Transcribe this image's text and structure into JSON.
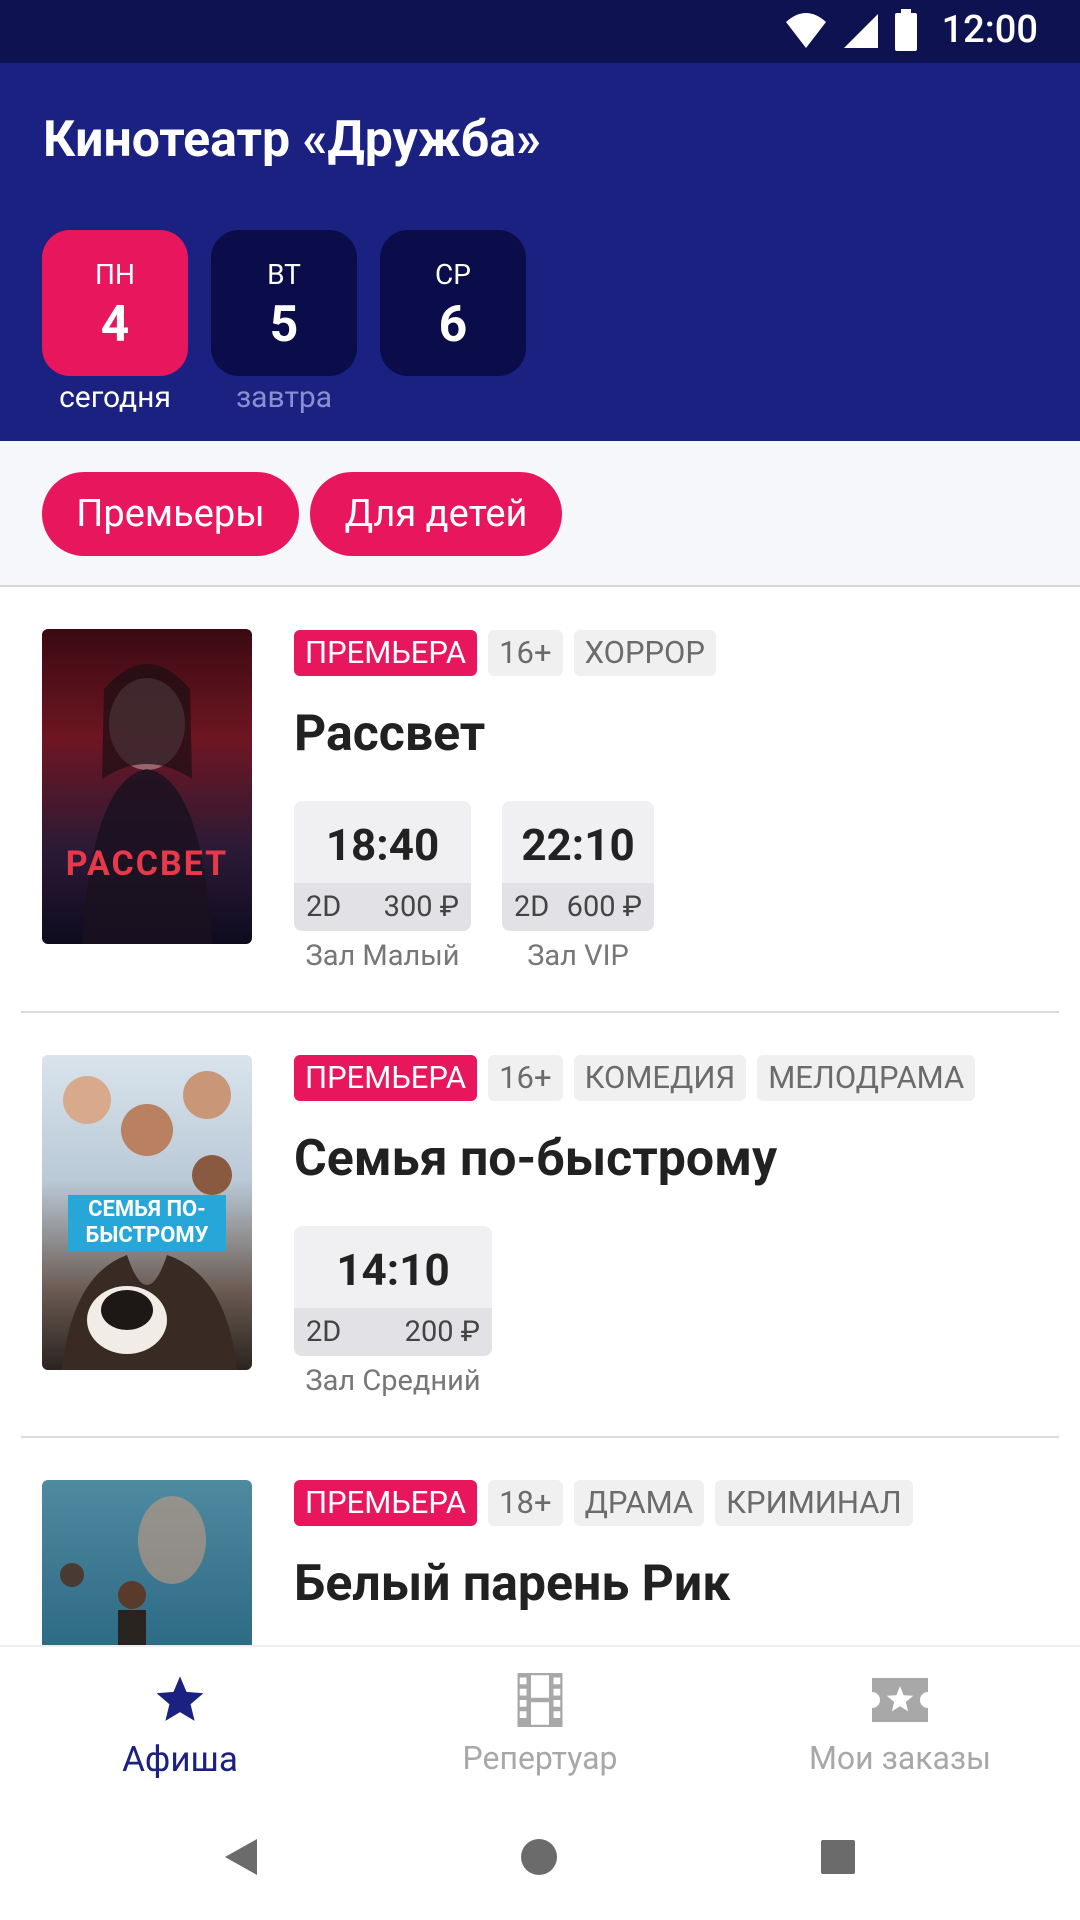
{
  "status_bar": {
    "time": "12:00"
  },
  "header": {
    "title": "Кинотеатр «Дружба»",
    "days": [
      {
        "dow": "ПН",
        "num": "4",
        "sub": "сегодня",
        "active": true
      },
      {
        "dow": "ВТ",
        "num": "5",
        "sub": "завтра",
        "active": false
      },
      {
        "dow": "СР",
        "num": "6",
        "sub": "",
        "active": false
      }
    ]
  },
  "filters": [
    "Премьеры",
    "Для детей"
  ],
  "movies": [
    {
      "tags": [
        "ПРЕМЬЕРА",
        "16+",
        "ХОРРОР"
      ],
      "title": "Рассвет",
      "poster_text": "РАССВЕТ",
      "sessions": [
        {
          "time": "18:40",
          "format": "2D",
          "price": "300 ₽",
          "hall": "Зал Малый"
        },
        {
          "time": "22:10",
          "format": "2D",
          "price": "600 ₽",
          "hall": "Зал VIP"
        }
      ]
    },
    {
      "tags": [
        "ПРЕМЬЕРА",
        "16+",
        "КОМЕДИЯ",
        "МЕЛОДРАМА"
      ],
      "title": "Семья по-быстрому",
      "poster_text": "СЕМЬЯ ПО-БЫСТРОМУ",
      "sessions": [
        {
          "time": "14:10",
          "format": "2D",
          "price": "200 ₽",
          "hall": "Зал Средний"
        }
      ]
    },
    {
      "tags": [
        "ПРЕМЬЕРА",
        "18+",
        "ДРАМА",
        "КРИМИНАЛ"
      ],
      "title": "Белый парень Рик",
      "poster_text": "",
      "sessions": []
    }
  ],
  "bottom_nav": [
    {
      "label": "Афиша",
      "icon": "star-icon",
      "active": true
    },
    {
      "label": "Репертуар",
      "icon": "film-icon",
      "active": false
    },
    {
      "label": "Мои заказы",
      "icon": "ticket-icon",
      "active": false
    }
  ],
  "colors": {
    "primary": "#1b2180",
    "status_bar": "#0f1250",
    "accent": "#e8175d",
    "day_inactive": "#0a0d4a"
  }
}
